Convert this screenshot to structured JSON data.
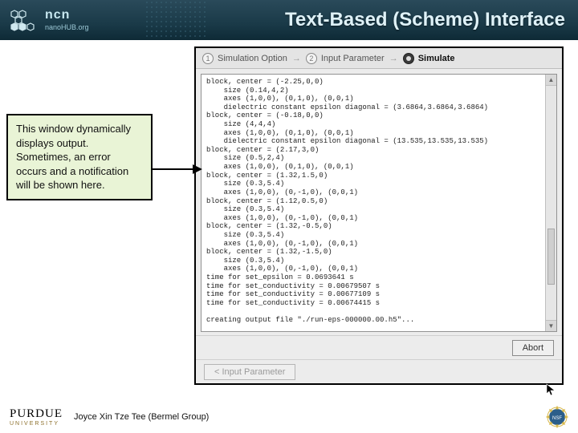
{
  "header": {
    "logo_main": "ncn",
    "logo_sub": "nanoHUB.org",
    "title": "Text-Based (Scheme) Interface"
  },
  "callout": {
    "text": "This window dynamically displays output. Sometimes, an error occurs and a notification will be shown here."
  },
  "breadcrumb": {
    "item1": "Simulation Option",
    "item2": "Input Parameter",
    "item3": "Simulate",
    "sep": "→"
  },
  "output_lines": [
    "block, center = (-2.25,0,0)",
    "    size (0.14,4,2)",
    "    axes (1,0,0), (0,1,0), (0,0,1)",
    "    dielectric constant epsilon diagonal = (3.6864,3.6864,3.6864)",
    "block, center = (-0.18,0,0)",
    "    size (4,4,4)",
    "    axes (1,0,0), (0,1,0), (0,0,1)",
    "    dielectric constant epsilon diagonal = (13.535,13.535,13.535)",
    "block, center = (2.17,3,0)",
    "    size (0.5,2,4)",
    "    axes (1,0,0), (0,1,0), (0,0,1)",
    "block, center = (1.32,1.5,0)",
    "    size (0.3,5.4)",
    "    axes (1,0,0), (0,-1,0), (0,0,1)",
    "block, center = (1.12,0.5,0)",
    "    size (0.3,5.4)",
    "    axes (1,0,0), (0,-1,0), (0,0,1)",
    "block, center = (1.32,-0.5,0)",
    "    size (0.3,5.4)",
    "    axes (1,0,0), (0,-1,0), (0,0,1)",
    "block, center = (1.32,-1.5,0)",
    "    size (0.3,5.4)",
    "    axes (1,0,0), (0,-1,0), (0,0,1)",
    "time for set_epsilon = 0.0693641 s",
    "time for set_conductivity = 0.00679507 s",
    "time for set_conductivity = 0.00677109 s",
    "time for set_conductivity = 0.00674415 s",
    "",
    "creating output file \"./run-eps-000000.00.h5\"..."
  ],
  "buttons": {
    "abort": "Abort",
    "back": "< Input Parameter"
  },
  "footer": {
    "univ_top": "PURDUE",
    "univ_bot": "UNIVERSITY",
    "author": "Joyce Xin Tze Tee (Bermel Group)"
  }
}
